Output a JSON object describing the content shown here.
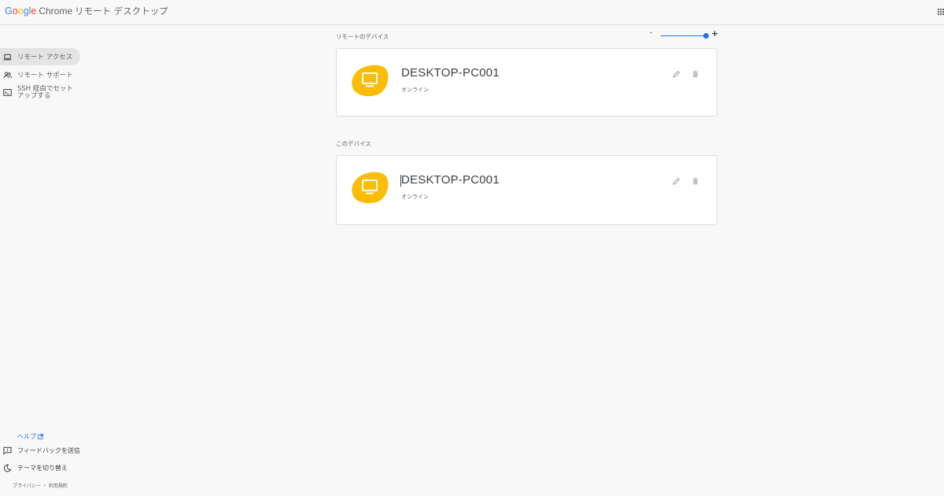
{
  "header": {
    "google_text": "Google",
    "chrome_text": "Chrome",
    "app_name": "リモート デスクトップ",
    "apps_icon": "apps-grid-icon"
  },
  "sidebar": {
    "items": [
      {
        "label": "リモート アクセス",
        "icon": "laptop-icon",
        "active": true
      },
      {
        "label": "リモート サポート",
        "icon": "people-icon",
        "active": false
      },
      {
        "label": "SSH 経由でセットアップする",
        "icon": "terminal-icon",
        "active": false
      }
    ],
    "help_label": "ヘルプ",
    "feedback_label": "フィードバックを送信",
    "theme_label": "テーマを切り替え",
    "legal_text": "プライバシー ・ 利用規約"
  },
  "main": {
    "remote_section_title": "リモートのデバイス",
    "this_section_title": "このデバイス",
    "zoom": {
      "minus": "-",
      "plus": "+",
      "level": 1.0
    },
    "remote_device": {
      "name": "DESKTOP-PC001",
      "status": "オンライン"
    },
    "this_device": {
      "name": "DESKTOP-PC001",
      "status": "オンライン"
    }
  },
  "colors": {
    "accent": "#1a73e8",
    "device_blob": "#fbbc04",
    "background": "#f8f8f8"
  }
}
